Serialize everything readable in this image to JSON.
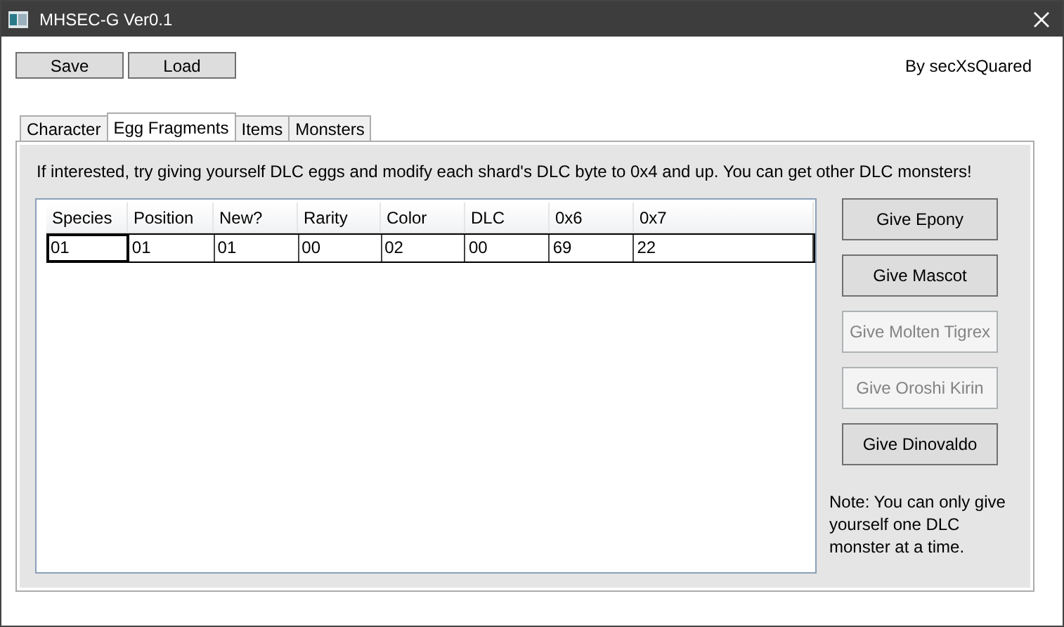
{
  "window": {
    "title": "MHSEC-G Ver0.1"
  },
  "toolbar": {
    "buttons": [
      "Save",
      "Load"
    ],
    "credit": "By secXsQuared"
  },
  "tabs": [
    {
      "label": "Character",
      "selected": false
    },
    {
      "label": "Egg Fragments",
      "selected": true
    },
    {
      "label": "Items",
      "selected": false
    },
    {
      "label": "Monsters",
      "selected": false
    }
  ],
  "hint": "If interested, try giving yourself DLC eggs and modify each shard's DLC byte to 0x4 and up. You can get other DLC monsters!",
  "table": {
    "columns": [
      "Species",
      "Position",
      "New?",
      "Rarity",
      "Color",
      "DLC",
      "0x6",
      "0x7"
    ],
    "rows": [
      {
        "selected": true,
        "cells": [
          {
            "text": "01",
            "focused": true
          },
          {
            "text": "01",
            "focused": false
          },
          {
            "text": "01",
            "focused": false
          },
          {
            "text": "00",
            "focused": false
          },
          {
            "text": "02",
            "focused": false
          },
          {
            "text": "00",
            "focused": false
          },
          {
            "text": "69",
            "focused": false
          },
          {
            "text": "22",
            "focused": false
          }
        ]
      }
    ]
  },
  "actions": [
    {
      "label": "Give Epony",
      "disabled": false
    },
    {
      "label": "Give Mascot",
      "disabled": false
    },
    {
      "label": "Give Molten Tigrex",
      "disabled": true
    },
    {
      "label": "Give Oroshi Kirin",
      "disabled": true
    },
    {
      "label": "Give Dinovaldo",
      "disabled": false
    }
  ],
  "note": "Note: You can only give yourself one DLC monster at a time."
}
